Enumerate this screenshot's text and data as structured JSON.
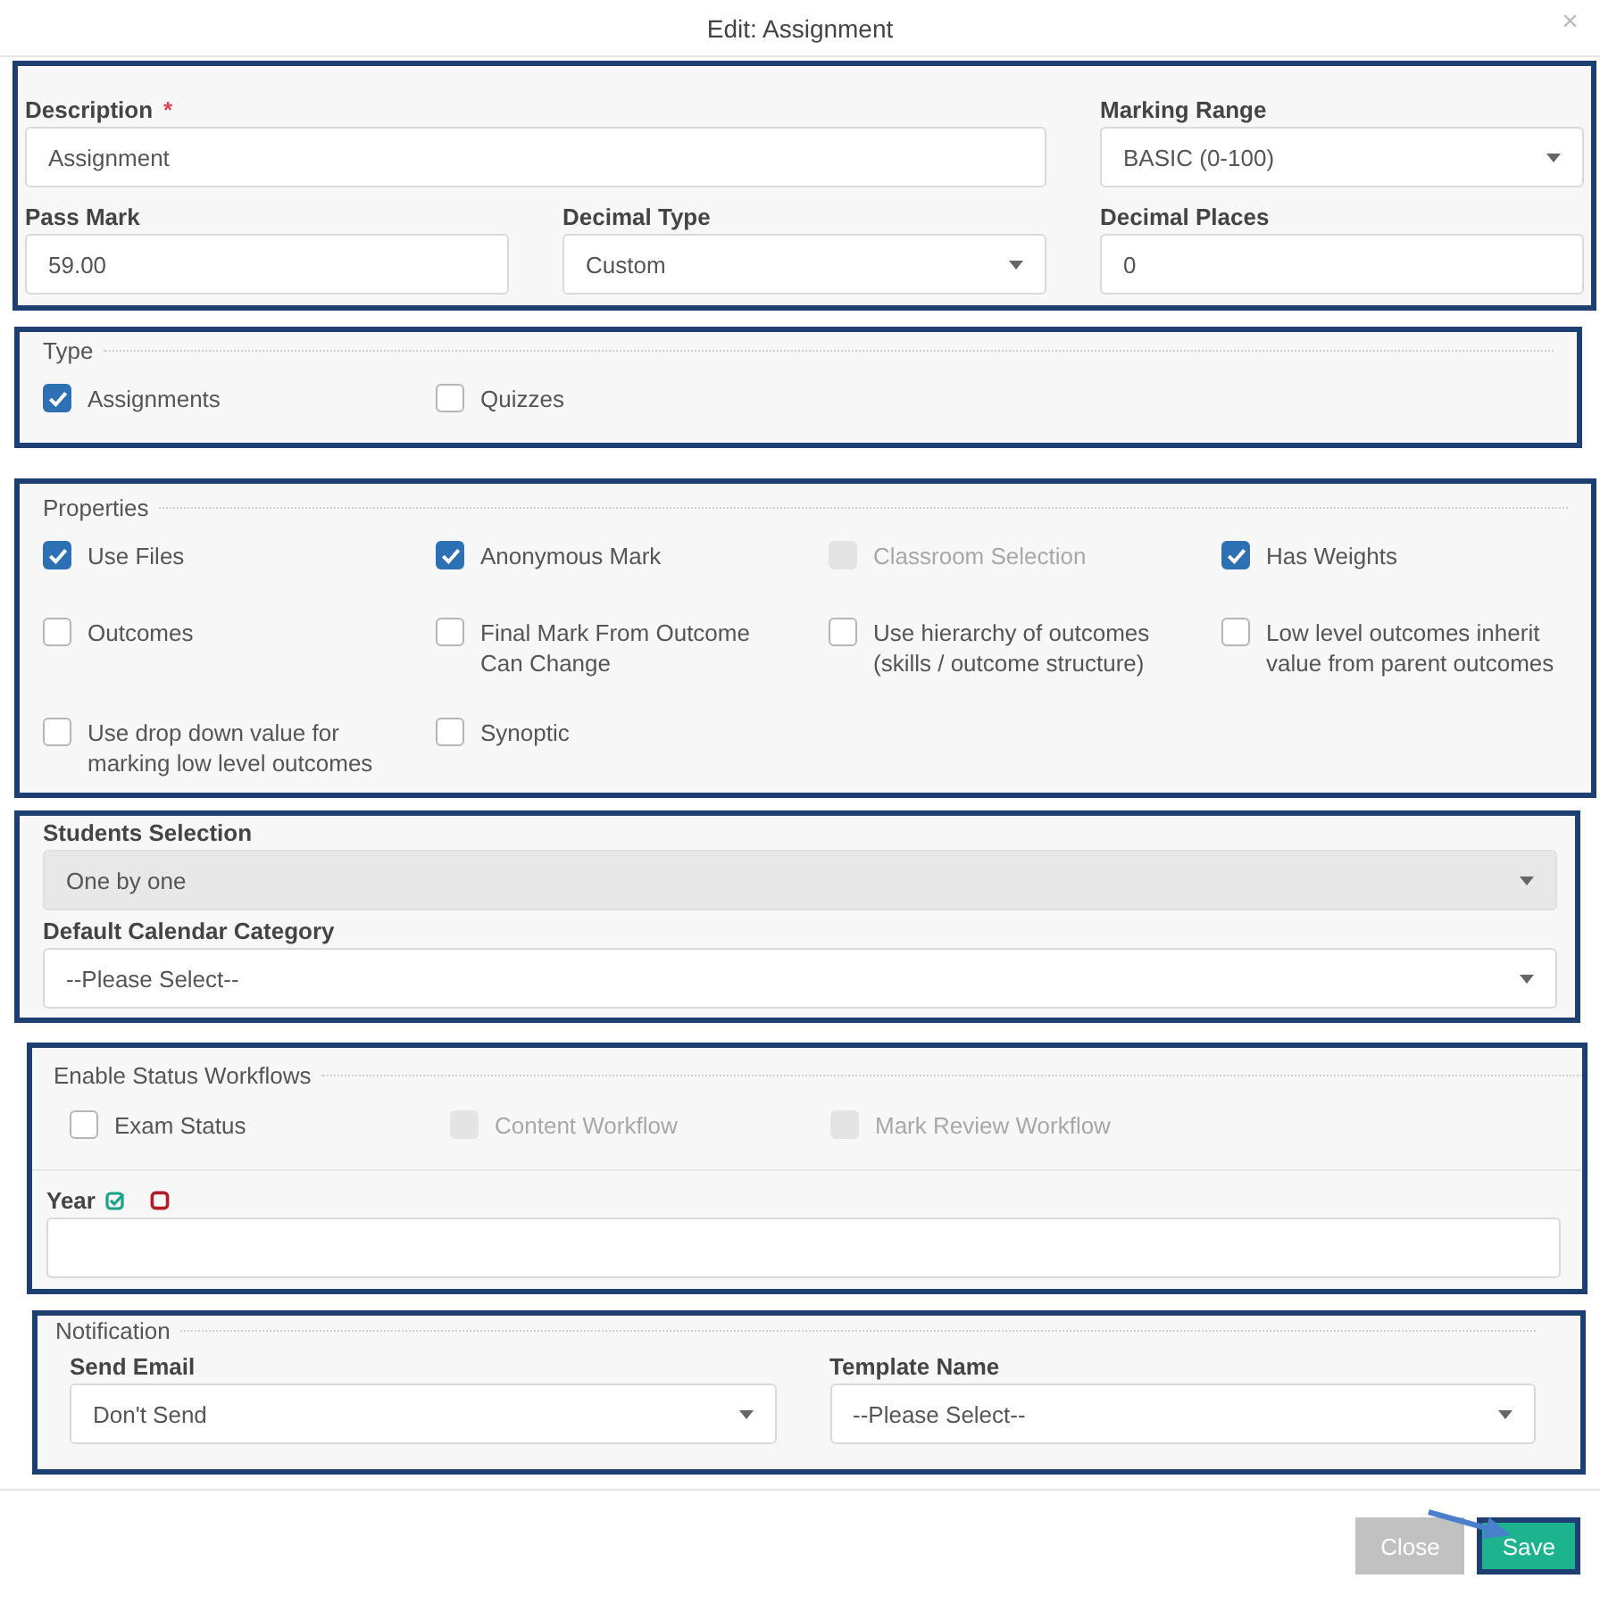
{
  "dialog": {
    "title": "Edit: Assignment",
    "close": "×"
  },
  "general": {
    "fields": [
      {
        "label": "Description",
        "required_mark": "*",
        "kind": "text",
        "value": "Assignment"
      },
      {
        "label": "Marking Range",
        "kind": "select",
        "value": "BASIC (0-100)"
      },
      {
        "label": "Pass Mark",
        "kind": "text",
        "value": "59.00"
      },
      {
        "label": "Decimal Type",
        "kind": "select",
        "value": "Custom"
      },
      {
        "label": "Decimal Places",
        "kind": "text",
        "value": "0"
      }
    ]
  },
  "type": {
    "legend": "Type",
    "options": [
      {
        "label": "Assignments",
        "checked": true,
        "disabled": false
      },
      {
        "label": "Quizzes",
        "checked": false,
        "disabled": false
      }
    ]
  },
  "properties": {
    "legend": "Properties",
    "options": [
      {
        "label": "Use Files",
        "checked": true,
        "disabled": false
      },
      {
        "label": "Anonymous Mark",
        "checked": true,
        "disabled": false
      },
      {
        "label": "Classroom Selection",
        "checked": false,
        "disabled": true
      },
      {
        "label": "Has Weights",
        "checked": true,
        "disabled": false
      },
      {
        "label": "Outcomes",
        "checked": false,
        "disabled": false
      },
      {
        "label": "Final Mark From Outcome Can Change",
        "checked": false,
        "disabled": false
      },
      {
        "label": "Use hierarchy of outcomes (skills / outcome structure)",
        "checked": false,
        "disabled": false
      },
      {
        "label": "Low level outcomes inherit value from parent outcomes",
        "checked": false,
        "disabled": false
      },
      {
        "label": "Use drop down value for marking low level outcomes",
        "checked": false,
        "disabled": false
      },
      {
        "label": "Synoptic",
        "checked": false,
        "disabled": false
      }
    ]
  },
  "students": {
    "fields": [
      {
        "label": "Students Selection",
        "kind": "select",
        "value": "One by one",
        "disabled": true
      },
      {
        "label": "Default Calendar Category",
        "kind": "select",
        "value": "--Please Select--",
        "disabled": false
      }
    ]
  },
  "workflows": {
    "legend": "Enable Status Workflows",
    "options": [
      {
        "label": "Exam Status",
        "checked": false,
        "disabled": false
      },
      {
        "label": "Content Workflow",
        "checked": false,
        "disabled": true
      },
      {
        "label": "Mark Review Workflow",
        "checked": false,
        "disabled": true
      }
    ],
    "year": {
      "label": "Year",
      "kind": "text"
    }
  },
  "notification": {
    "legend": "Notification",
    "fields": [
      {
        "label": "Send Email",
        "kind": "select",
        "value": "Don't Send"
      },
      {
        "label": "Template Name",
        "kind": "select",
        "value": "--Please Select--"
      }
    ]
  },
  "buttons": [
    {
      "label": "Close",
      "kind": "secondary"
    },
    {
      "label": "Save",
      "kind": "primary"
    }
  ]
}
